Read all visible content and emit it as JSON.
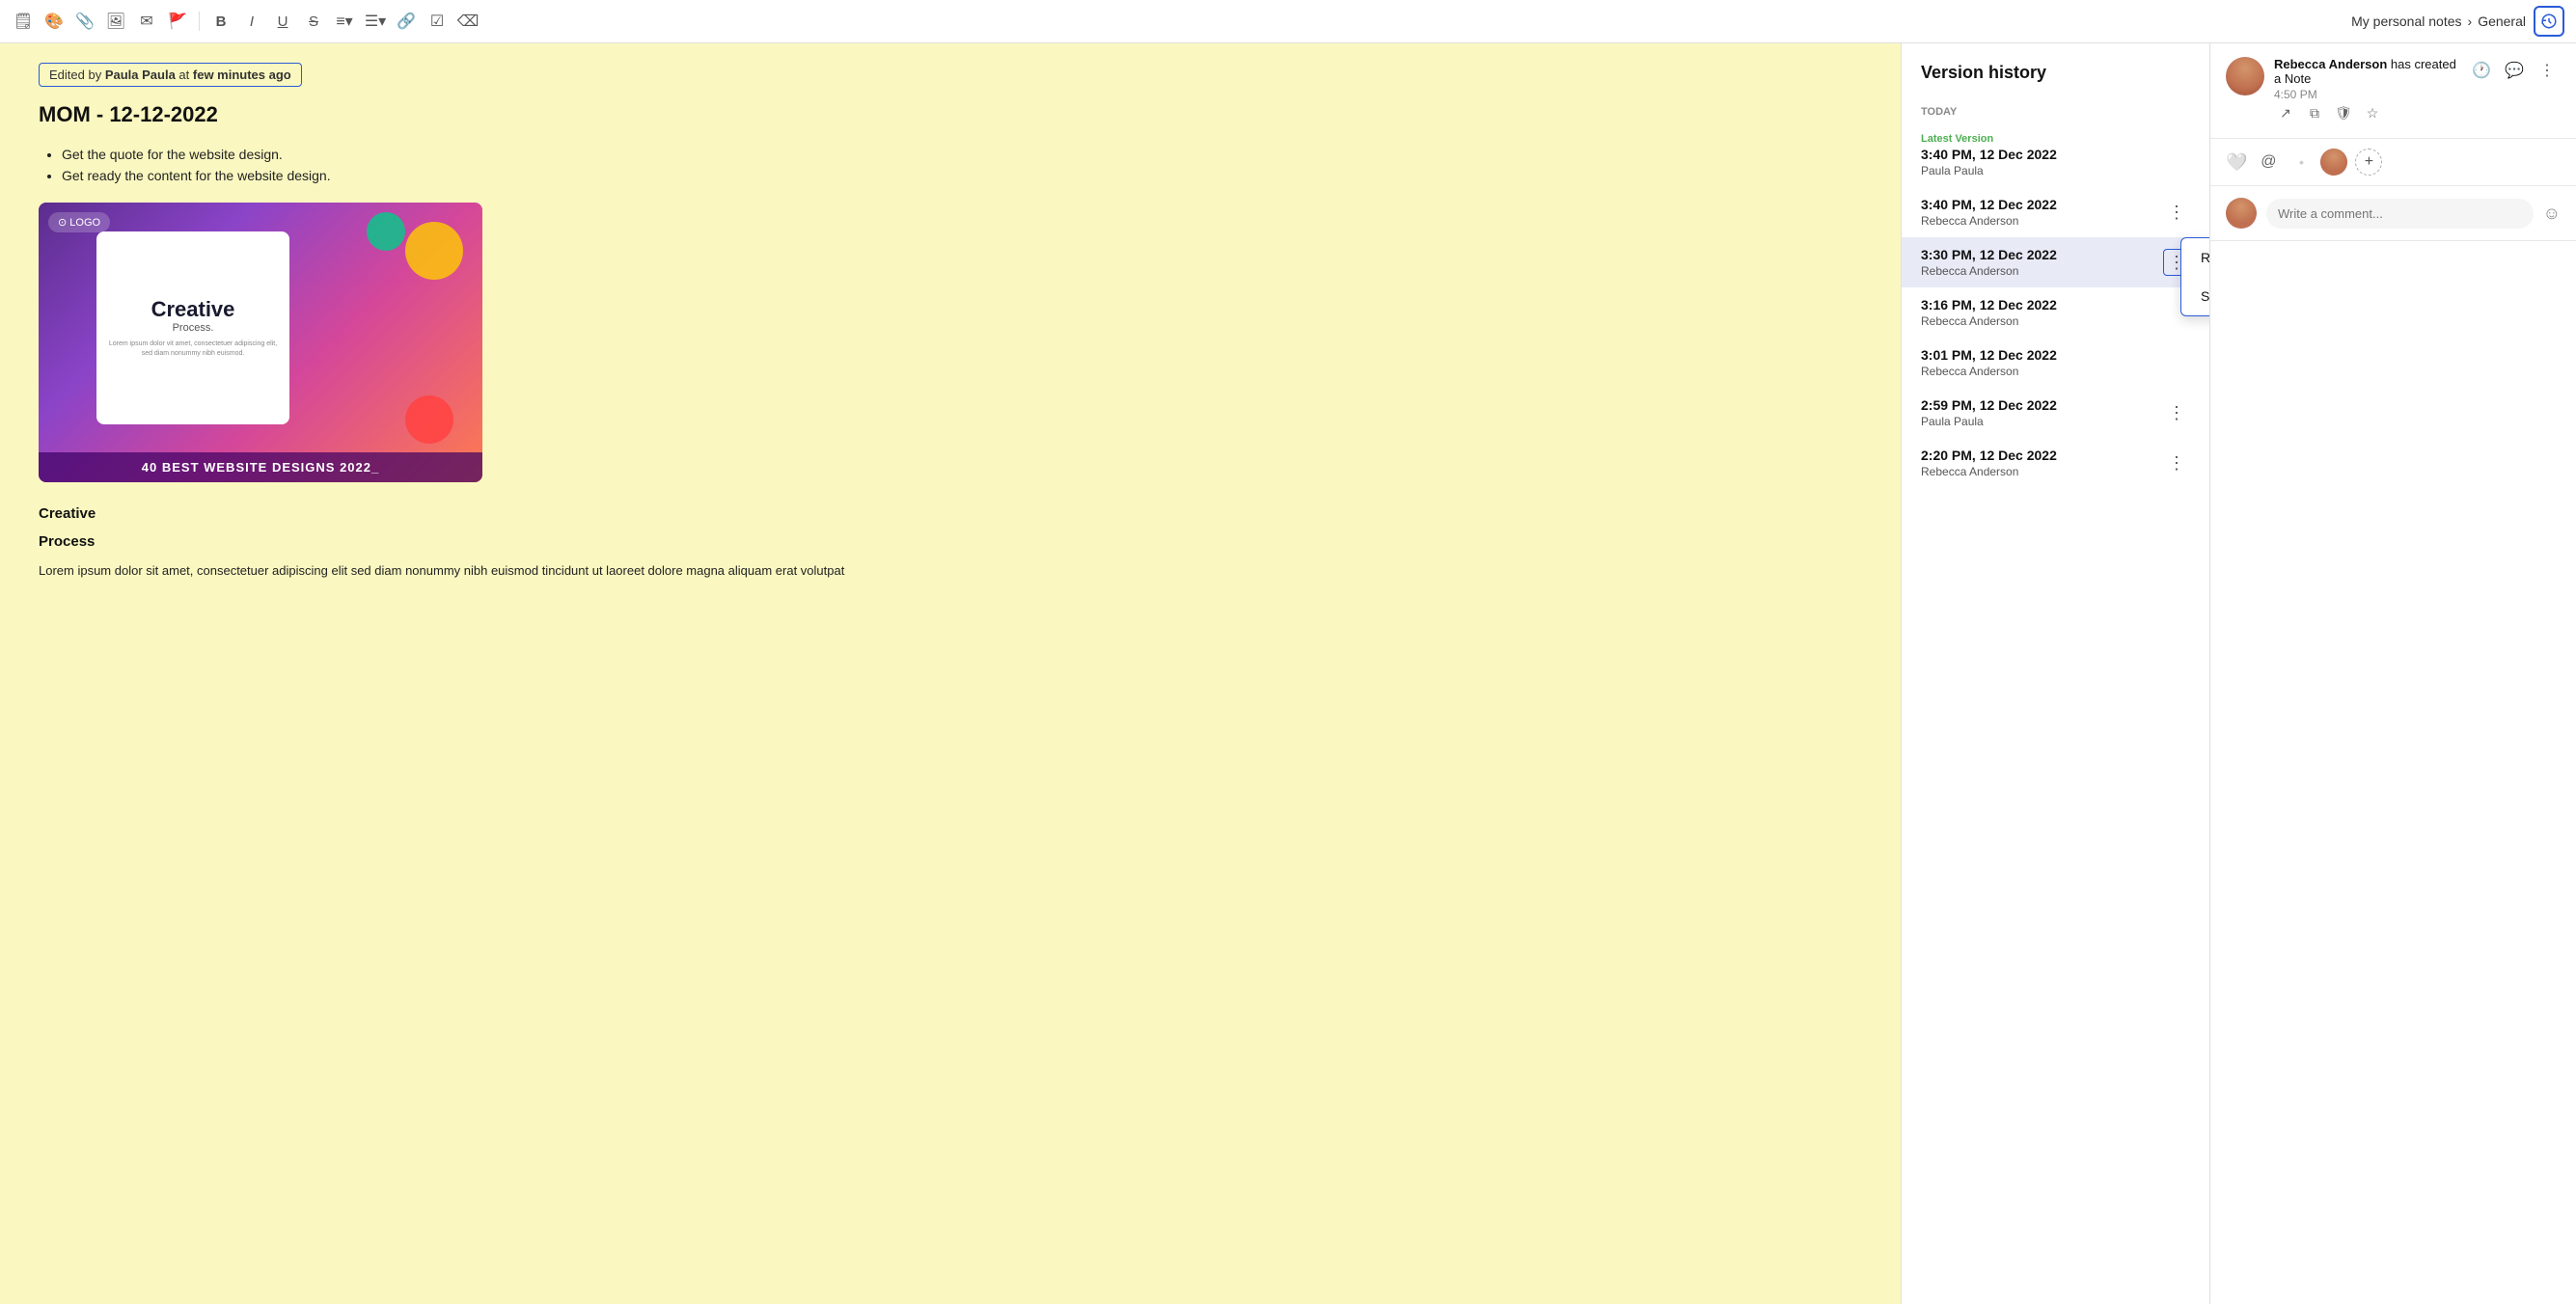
{
  "toolbar": {
    "breadcrumb": {
      "part1": "My personal notes",
      "separator": "›",
      "part2": "General"
    },
    "version_history_label": "version-history"
  },
  "editor": {
    "edited_by_prefix": "Edited by ",
    "edited_by_name": "Paula Paula",
    "edited_by_suffix": " at ",
    "edited_by_time": "few minutes ago",
    "doc_title": "MOM - 12-12-2022",
    "bullet_items": [
      "Get the quote for the website design.",
      "Get ready the content for the website design."
    ],
    "image_overlay_text": "40 BEST WEBSITE DESIGNS 2022_",
    "image_logo": "⊙ LOGO",
    "image_card_title": "Creative",
    "image_card_subtitle": "Process.",
    "image_card_text": "Lorem ipsum dolor vit amet, consectetuer adipiscing elit, sed diam nonummy nibh euismod.",
    "section1_title": "Creative",
    "section2_title": "Process",
    "body_text": "Lorem ipsum dolor sit amet, consectetuer adipiscing elit sed diam nonummy nibh euismod tincidunt ut laoreet dolore magna aliquam erat volutpat"
  },
  "version_panel": {
    "title": "Version history",
    "section_today": "TODAY",
    "versions": [
      {
        "id": "v1",
        "latest_tag": "Latest Version",
        "time": "3:40 PM, 12 Dec 2022",
        "author": "Paula Paula",
        "selected": false,
        "show_more": false,
        "context_menu": false
      },
      {
        "id": "v2",
        "latest_tag": "",
        "time": "3:40 PM, 12 Dec 2022",
        "author": "Rebecca Anderson",
        "selected": false,
        "show_more": true,
        "context_menu": false
      },
      {
        "id": "v3",
        "latest_tag": "",
        "time": "3:30 PM, 12 Dec 2022",
        "author": "Rebecca Anderson",
        "selected": true,
        "show_more": true,
        "context_menu": true
      },
      {
        "id": "v4",
        "latest_tag": "",
        "time": "3:16 PM, 12 Dec 2022",
        "author": "Rebecca Anderson",
        "selected": false,
        "show_more": false,
        "context_menu": false
      },
      {
        "id": "v5",
        "latest_tag": "",
        "time": "3:01 PM, 12 Dec 2022",
        "author": "Rebecca Anderson",
        "selected": false,
        "show_more": false,
        "context_menu": false
      },
      {
        "id": "v6",
        "latest_tag": "",
        "time": "2:59 PM, 12 Dec 2022",
        "author": "Paula Paula",
        "selected": false,
        "show_more": true,
        "context_menu": false
      },
      {
        "id": "v7",
        "latest_tag": "",
        "time": "2:20 PM, 12 Dec 2022",
        "author": "Rebecca Anderson",
        "selected": false,
        "show_more": true,
        "context_menu": false
      }
    ],
    "context_menu_items": [
      "Restore this version",
      "Save as new"
    ]
  },
  "right_sidebar": {
    "notification": {
      "user_name": "Rebecca Anderson",
      "action": " has created a Note",
      "time": "4:50 PM"
    },
    "comment_placeholder": "Write a comment..."
  }
}
